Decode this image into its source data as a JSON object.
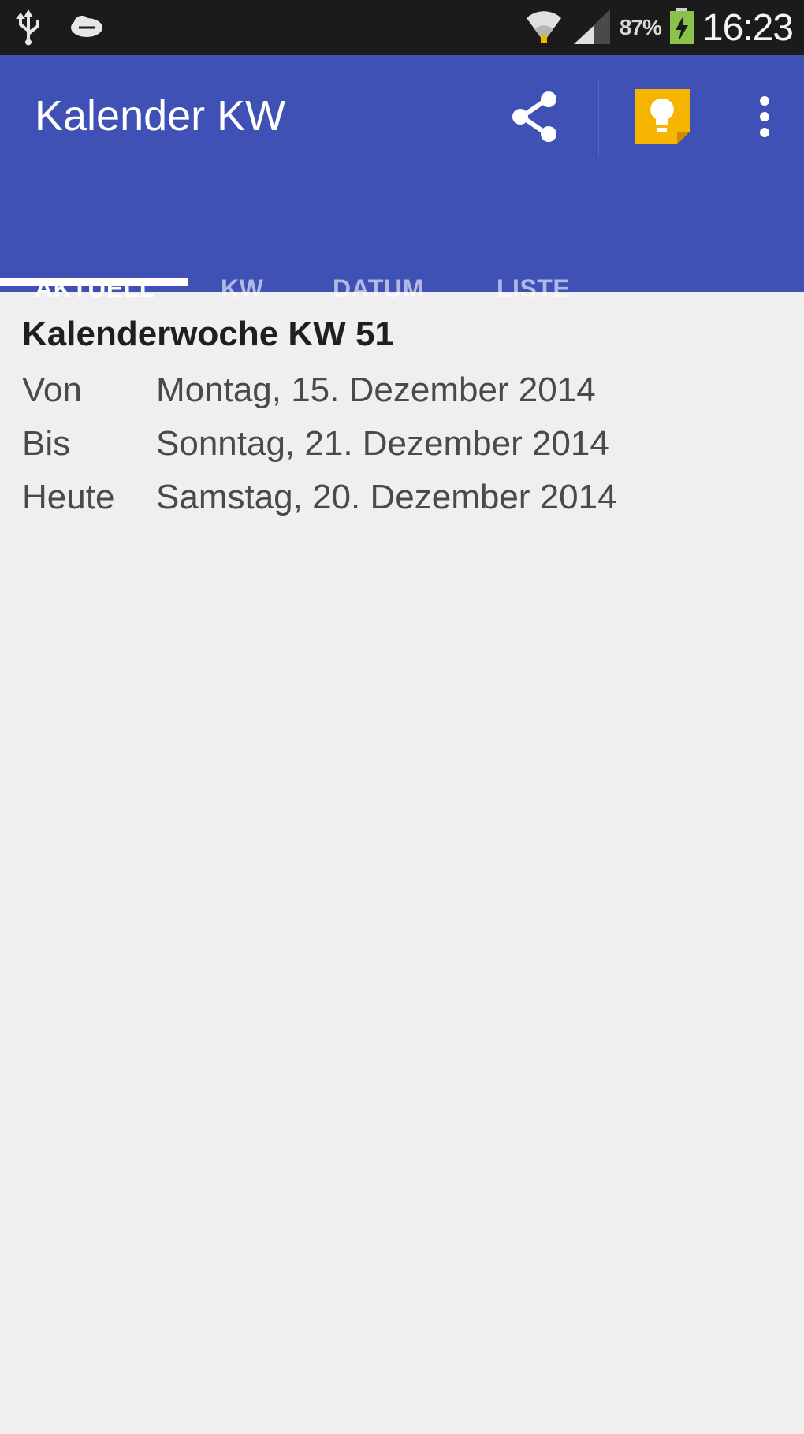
{
  "status_bar": {
    "battery_percent": "87%",
    "time": "16:23"
  },
  "app_bar": {
    "title": "Kalender KW",
    "color": "#3f51b5",
    "icons": [
      "share-icon",
      "keep-bulb-icon",
      "overflow-menu-icon"
    ]
  },
  "tabs": [
    {
      "label": "AKTUELL"
    },
    {
      "label": "KW"
    },
    {
      "label": "DATUM"
    },
    {
      "label": "LISTE"
    }
  ],
  "content": {
    "heading": "Kalenderwoche KW 51",
    "rows": [
      {
        "label": "Von",
        "value": "Montag, 15. Dezember 2014"
      },
      {
        "label": "Bis",
        "value": "Sonntag, 21. Dezember 2014"
      },
      {
        "label": "Heute",
        "value": "Samstag, 20. Dezember 2014"
      }
    ]
  }
}
